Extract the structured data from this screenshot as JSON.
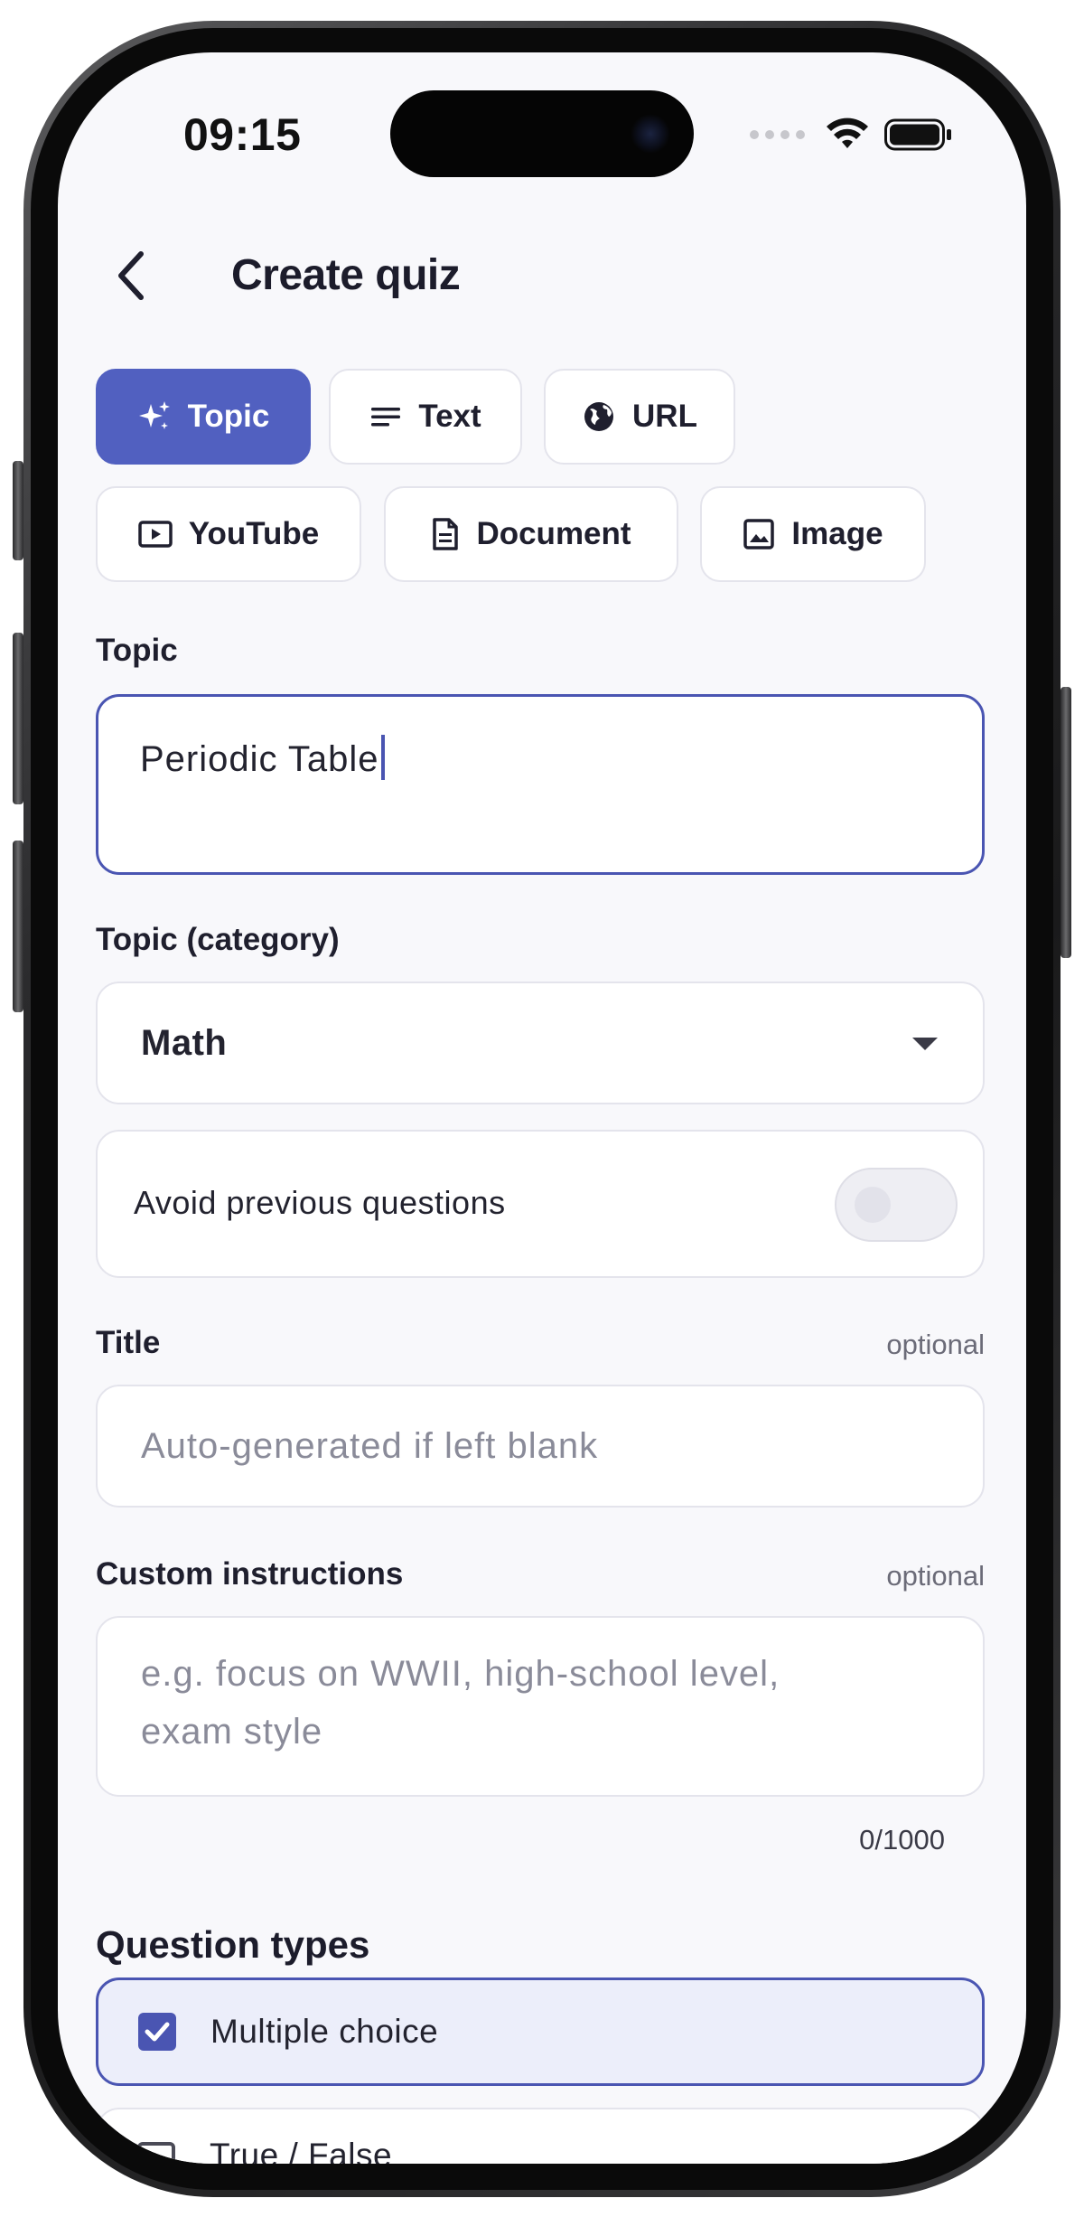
{
  "status_bar": {
    "time": "09:15"
  },
  "header": {
    "title": "Create quiz",
    "back_icon": "chevron-left-icon"
  },
  "source_tabs": [
    {
      "label": "Topic",
      "icon": "sparkles-icon",
      "active": true
    },
    {
      "label": "Text",
      "icon": "text-lines-icon",
      "active": false
    },
    {
      "label": "URL",
      "icon": "globe-icon",
      "active": false
    },
    {
      "label": "YouTube",
      "icon": "play-video-icon",
      "active": false
    },
    {
      "label": "Document",
      "icon": "document-icon",
      "active": false
    },
    {
      "label": "Image",
      "icon": "image-icon",
      "active": false
    }
  ],
  "topic": {
    "label": "Topic",
    "value": "Periodic Table"
  },
  "category": {
    "label": "Topic (category)",
    "value": "Math"
  },
  "avoid_previous": {
    "label": "Avoid previous questions",
    "enabled": false
  },
  "title_field": {
    "label": "Title",
    "optional": "optional",
    "placeholder": "Auto-generated if left blank"
  },
  "instructions": {
    "label": "Custom instructions",
    "optional": "optional",
    "placeholder_line1": "e.g. focus on WWII, high-school level,",
    "placeholder_line2": "exam style",
    "counter": "0/1000"
  },
  "question_types": {
    "title": "Question types",
    "items": [
      {
        "label": "Multiple choice",
        "checked": true
      },
      {
        "label": "True / False",
        "checked": false
      }
    ]
  },
  "colors": {
    "accent": "#5160c0",
    "focus_border": "#4a55b2",
    "selected_row_bg": "#eceefa",
    "screen_bg": "#f8f8fb"
  }
}
